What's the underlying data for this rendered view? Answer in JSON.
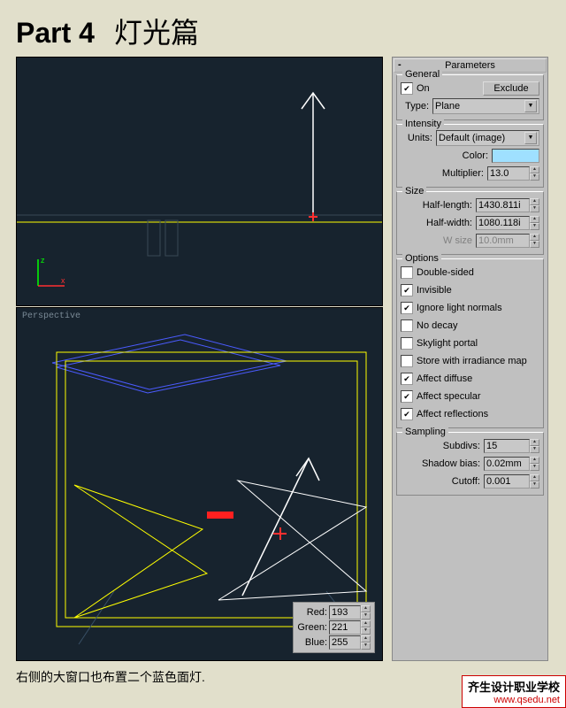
{
  "title_part": "Part 4",
  "title_cn": "灯光篇",
  "viewport": {
    "perspective_label": "Perspective"
  },
  "rgb": {
    "red_label": "Red:",
    "red": "193",
    "green_label": "Green:",
    "green": "221",
    "blue_label": "Blue:",
    "blue": "255"
  },
  "params": {
    "header": "Parameters",
    "general": {
      "title": "General",
      "on_label": "On",
      "on": true,
      "exclude_btn": "Exclude",
      "type_label": "Type:",
      "type_value": "Plane"
    },
    "intensity": {
      "title": "Intensity",
      "units_label": "Units:",
      "units_value": "Default (image)",
      "color_label": "Color:",
      "color": "#9FE0FF",
      "multiplier_label": "Multiplier:",
      "multiplier": "13.0"
    },
    "size": {
      "title": "Size",
      "half_length_label": "Half-length:",
      "half_length": "1430.811i",
      "half_width_label": "Half-width:",
      "half_width": "1080.118i",
      "w_size_label": "W size",
      "w_size": "10.0mm"
    },
    "options": {
      "title": "Options",
      "double_sided": "Double-sided",
      "double_sided_v": false,
      "invisible": "Invisible",
      "invisible_v": true,
      "ignore_normals": "Ignore light normals",
      "ignore_normals_v": true,
      "no_decay": "No decay",
      "no_decay_v": false,
      "skylight_portal": "Skylight portal",
      "skylight_portal_v": false,
      "store_irr": "Store with irradiance map",
      "store_irr_v": false,
      "affect_diffuse": "Affect diffuse",
      "affect_diffuse_v": true,
      "affect_specular": "Affect specular",
      "affect_specular_v": true,
      "affect_reflections": "Affect reflections",
      "affect_reflections_v": true
    },
    "sampling": {
      "title": "Sampling",
      "subdivs_label": "Subdivs:",
      "subdivs": "15",
      "shadow_bias_label": "Shadow bias:",
      "shadow_bias": "0.02mm",
      "cutoff_label": "Cutoff:",
      "cutoff": "0.001"
    }
  },
  "caption": "右侧的大窗口也布置二个蓝色面灯.",
  "footer": {
    "line1": "齐生设计职业学校",
    "line2": "www.qsedu.net"
  }
}
